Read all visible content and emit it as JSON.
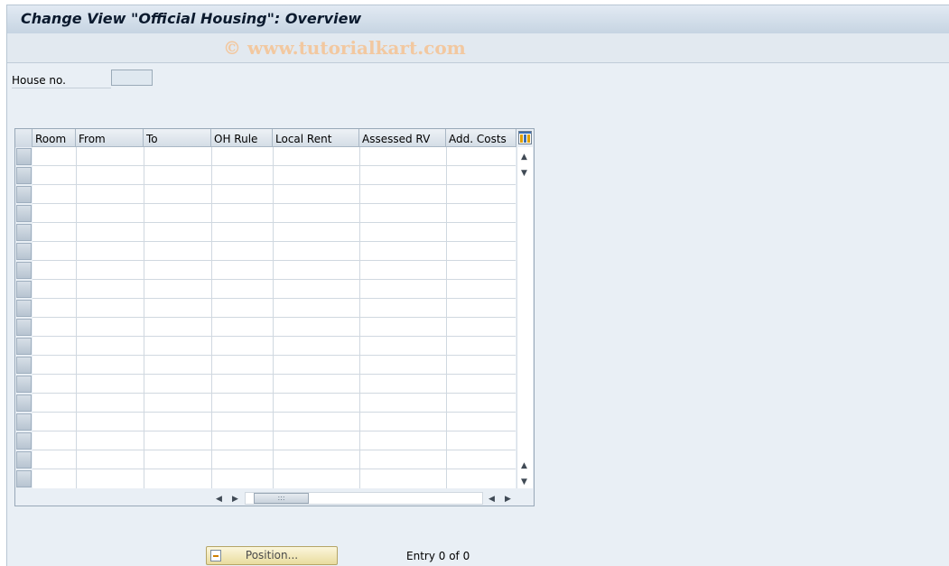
{
  "header": {
    "title": "Change View \"Official Housing\": Overview"
  },
  "watermark": "© www.tutorialkart.com",
  "form": {
    "house_label": "House no.",
    "house_value": ""
  },
  "table": {
    "columns": [
      "Room",
      "From",
      "To",
      "OH Rule",
      "Local Rent",
      "Assessed RV",
      "Add. Costs"
    ],
    "rows": []
  },
  "footer": {
    "position_label": "Position...",
    "entry_text": "Entry 0 of 0"
  },
  "icons": {
    "settings": "table-settings-icon",
    "position": "position-icon",
    "scroll_up": "▲",
    "scroll_down": "▼",
    "scroll_left": "◀",
    "scroll_right": "▶",
    "grip": ":::"
  }
}
